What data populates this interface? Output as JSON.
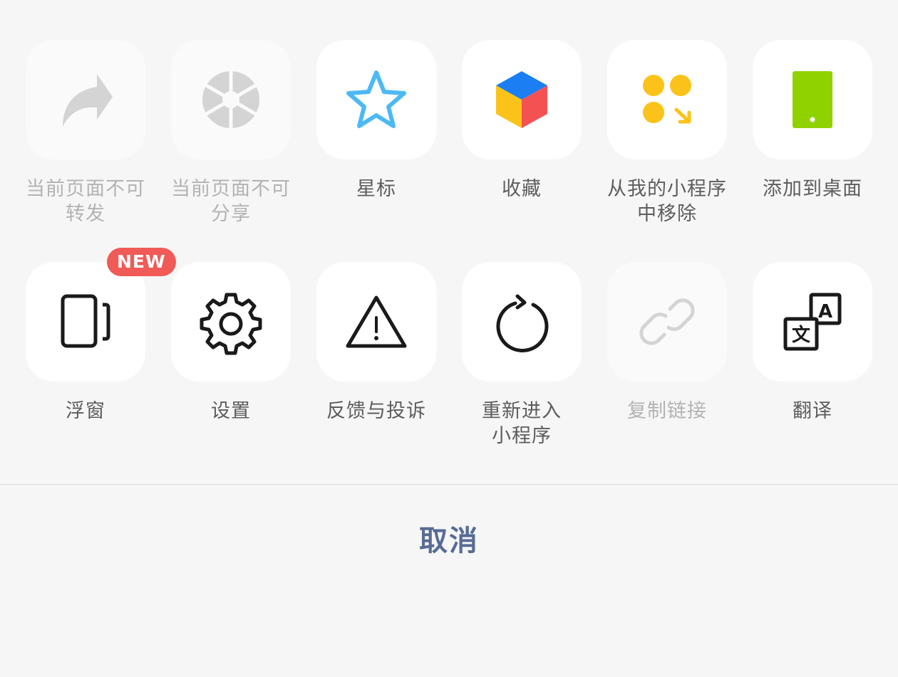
{
  "menu": {
    "row1": [
      {
        "label": "当前页面不可\n转发",
        "icon": "share-arrow-icon",
        "disabled": true
      },
      {
        "label": "当前页面不可\n分享",
        "icon": "moments-aperture-icon",
        "disabled": true
      },
      {
        "label": "星标",
        "icon": "star-icon",
        "disabled": false
      },
      {
        "label": "收藏",
        "icon": "favorites-cube-icon",
        "disabled": false
      },
      {
        "label": "从我的小程序\n中移除",
        "icon": "remove-miniprogram-icon",
        "disabled": false
      },
      {
        "label": "添加到桌面",
        "icon": "add-to-desktop-icon",
        "disabled": false
      }
    ],
    "row2": [
      {
        "label": "浮窗",
        "icon": "floating-window-icon",
        "disabled": false,
        "badge": "NEW"
      },
      {
        "label": "设置",
        "icon": "gear-icon",
        "disabled": false
      },
      {
        "label": "反馈与投诉",
        "icon": "warning-icon",
        "disabled": false
      },
      {
        "label": "重新进入\n小程序",
        "icon": "reload-icon",
        "disabled": false
      },
      {
        "label": "复制链接",
        "icon": "link-icon",
        "disabled": true
      },
      {
        "label": "翻译",
        "icon": "translate-icon",
        "disabled": false
      }
    ]
  },
  "cancel_label": "取消",
  "colors": {
    "background": "#f6f6f6",
    "tile": "#ffffff",
    "label": "#5d5d5d",
    "label_disabled": "#b3b3b3",
    "icon_disabled": "#d4d4d4",
    "star": "#4cb9f5",
    "cube_top": "#1b7ef2",
    "cube_left": "#fbc31a",
    "cube_right": "#f45152",
    "yellow": "#fbc31a",
    "green": "#8fd200",
    "badge": "#f05a57",
    "cancel": "#576b95"
  }
}
